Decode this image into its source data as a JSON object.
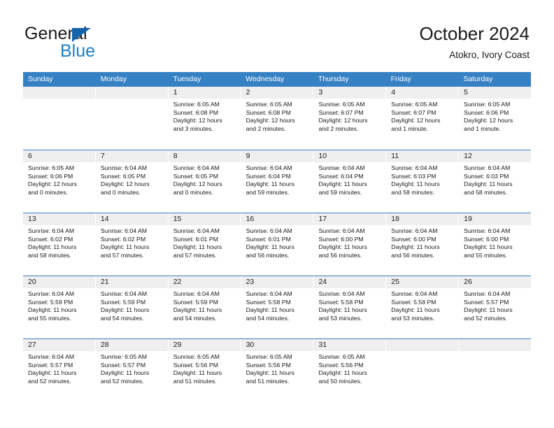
{
  "brand": {
    "name_part1": "General",
    "name_part2": "Blue",
    "triangle_color": "#1565ad",
    "blue_color": "#1f7dc4"
  },
  "header": {
    "title": "October 2024",
    "subtitle": "Atokro, Ivory Coast"
  },
  "theme": {
    "header_blue": "#3681c4",
    "daynum_band": "#efefef",
    "text": "#1a1a1a"
  },
  "calendar": {
    "weekday_headers": [
      "Sunday",
      "Monday",
      "Tuesday",
      "Wednesday",
      "Thursday",
      "Friday",
      "Saturday"
    ],
    "weeks": [
      [
        {
          "day": "",
          "lines": []
        },
        {
          "day": "",
          "lines": []
        },
        {
          "day": "1",
          "lines": [
            "Sunrise: 6:05 AM",
            "Sunset: 6:08 PM",
            "Daylight: 12 hours",
            "and 3 minutes."
          ]
        },
        {
          "day": "2",
          "lines": [
            "Sunrise: 6:05 AM",
            "Sunset: 6:08 PM",
            "Daylight: 12 hours",
            "and 2 minutes."
          ]
        },
        {
          "day": "3",
          "lines": [
            "Sunrise: 6:05 AM",
            "Sunset: 6:07 PM",
            "Daylight: 12 hours",
            "and 2 minutes."
          ]
        },
        {
          "day": "4",
          "lines": [
            "Sunrise: 6:05 AM",
            "Sunset: 6:07 PM",
            "Daylight: 12 hours",
            "and 1 minute."
          ]
        },
        {
          "day": "5",
          "lines": [
            "Sunrise: 6:05 AM",
            "Sunset: 6:06 PM",
            "Daylight: 12 hours",
            "and 1 minute."
          ]
        }
      ],
      [
        {
          "day": "6",
          "lines": [
            "Sunrise: 6:05 AM",
            "Sunset: 6:06 PM",
            "Daylight: 12 hours",
            "and 0 minutes."
          ]
        },
        {
          "day": "7",
          "lines": [
            "Sunrise: 6:04 AM",
            "Sunset: 6:05 PM",
            "Daylight: 12 hours",
            "and 0 minutes."
          ]
        },
        {
          "day": "8",
          "lines": [
            "Sunrise: 6:04 AM",
            "Sunset: 6:05 PM",
            "Daylight: 12 hours",
            "and 0 minutes."
          ]
        },
        {
          "day": "9",
          "lines": [
            "Sunrise: 6:04 AM",
            "Sunset: 6:04 PM",
            "Daylight: 11 hours",
            "and 59 minutes."
          ]
        },
        {
          "day": "10",
          "lines": [
            "Sunrise: 6:04 AM",
            "Sunset: 6:04 PM",
            "Daylight: 11 hours",
            "and 59 minutes."
          ]
        },
        {
          "day": "11",
          "lines": [
            "Sunrise: 6:04 AM",
            "Sunset: 6:03 PM",
            "Daylight: 11 hours",
            "and 58 minutes."
          ]
        },
        {
          "day": "12",
          "lines": [
            "Sunrise: 6:04 AM",
            "Sunset: 6:03 PM",
            "Daylight: 11 hours",
            "and 58 minutes."
          ]
        }
      ],
      [
        {
          "day": "13",
          "lines": [
            "Sunrise: 6:04 AM",
            "Sunset: 6:02 PM",
            "Daylight: 11 hours",
            "and 58 minutes."
          ]
        },
        {
          "day": "14",
          "lines": [
            "Sunrise: 6:04 AM",
            "Sunset: 6:02 PM",
            "Daylight: 11 hours",
            "and 57 minutes."
          ]
        },
        {
          "day": "15",
          "lines": [
            "Sunrise: 6:04 AM",
            "Sunset: 6:01 PM",
            "Daylight: 11 hours",
            "and 57 minutes."
          ]
        },
        {
          "day": "16",
          "lines": [
            "Sunrise: 6:04 AM",
            "Sunset: 6:01 PM",
            "Daylight: 11 hours",
            "and 56 minutes."
          ]
        },
        {
          "day": "17",
          "lines": [
            "Sunrise: 6:04 AM",
            "Sunset: 6:00 PM",
            "Daylight: 11 hours",
            "and 56 minutes."
          ]
        },
        {
          "day": "18",
          "lines": [
            "Sunrise: 6:04 AM",
            "Sunset: 6:00 PM",
            "Daylight: 11 hours",
            "and 56 minutes."
          ]
        },
        {
          "day": "19",
          "lines": [
            "Sunrise: 6:04 AM",
            "Sunset: 6:00 PM",
            "Daylight: 11 hours",
            "and 55 minutes."
          ]
        }
      ],
      [
        {
          "day": "20",
          "lines": [
            "Sunrise: 6:04 AM",
            "Sunset: 5:59 PM",
            "Daylight: 11 hours",
            "and 55 minutes."
          ]
        },
        {
          "day": "21",
          "lines": [
            "Sunrise: 6:04 AM",
            "Sunset: 5:59 PM",
            "Daylight: 11 hours",
            "and 54 minutes."
          ]
        },
        {
          "day": "22",
          "lines": [
            "Sunrise: 6:04 AM",
            "Sunset: 5:59 PM",
            "Daylight: 11 hours",
            "and 54 minutes."
          ]
        },
        {
          "day": "23",
          "lines": [
            "Sunrise: 6:04 AM",
            "Sunset: 5:58 PM",
            "Daylight: 11 hours",
            "and 54 minutes."
          ]
        },
        {
          "day": "24",
          "lines": [
            "Sunrise: 6:04 AM",
            "Sunset: 5:58 PM",
            "Daylight: 11 hours",
            "and 53 minutes."
          ]
        },
        {
          "day": "25",
          "lines": [
            "Sunrise: 6:04 AM",
            "Sunset: 5:58 PM",
            "Daylight: 11 hours",
            "and 53 minutes."
          ]
        },
        {
          "day": "26",
          "lines": [
            "Sunrise: 6:04 AM",
            "Sunset: 5:57 PM",
            "Daylight: 11 hours",
            "and 52 minutes."
          ]
        }
      ],
      [
        {
          "day": "27",
          "lines": [
            "Sunrise: 6:04 AM",
            "Sunset: 5:57 PM",
            "Daylight: 11 hours",
            "and 52 minutes."
          ]
        },
        {
          "day": "28",
          "lines": [
            "Sunrise: 6:05 AM",
            "Sunset: 5:57 PM",
            "Daylight: 11 hours",
            "and 52 minutes."
          ]
        },
        {
          "day": "29",
          "lines": [
            "Sunrise: 6:05 AM",
            "Sunset: 5:56 PM",
            "Daylight: 11 hours",
            "and 51 minutes."
          ]
        },
        {
          "day": "30",
          "lines": [
            "Sunrise: 6:05 AM",
            "Sunset: 5:56 PM",
            "Daylight: 11 hours",
            "and 51 minutes."
          ]
        },
        {
          "day": "31",
          "lines": [
            "Sunrise: 6:05 AM",
            "Sunset: 5:56 PM",
            "Daylight: 11 hours",
            "and 50 minutes."
          ]
        },
        {
          "day": "",
          "lines": []
        },
        {
          "day": "",
          "lines": []
        }
      ]
    ]
  }
}
